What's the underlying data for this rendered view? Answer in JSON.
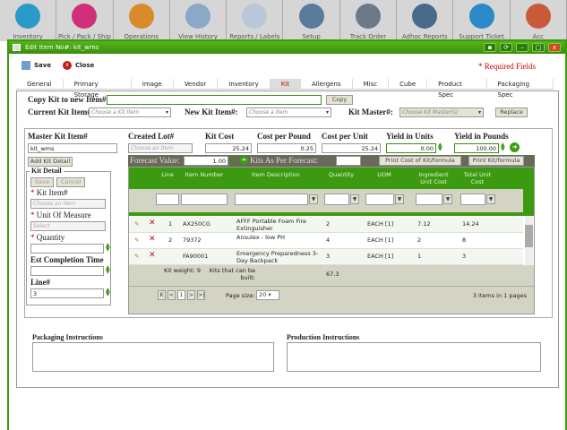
{
  "top_nav": [
    {
      "label": "Inventory",
      "color": "#2a9ac8"
    },
    {
      "label": "Pick / Pack / Ship",
      "color": "#d0307a"
    },
    {
      "label": "Operations",
      "color": "#d98a2a"
    },
    {
      "label": "View History",
      "color": "#8aa8c8"
    },
    {
      "label": "Reports / Labels",
      "color": "#b8c8d8"
    },
    {
      "label": "Setup",
      "color": "#5a7a9a"
    },
    {
      "label": "Track Order",
      "color": "#6a7a8a"
    },
    {
      "label": "Adhoc Reports",
      "color": "#4a6a8a"
    },
    {
      "label": "Support Ticket",
      "color": "#2a8ac8"
    },
    {
      "label": "Acc",
      "color": "#c85a3a"
    }
  ],
  "window": {
    "title": "Edit Item No#: kit_wms",
    "save": "Save",
    "close": "Close",
    "required": "* Required Fields"
  },
  "tabs": [
    "General",
    "Primary Storage",
    "Image",
    "Vendor",
    "Inventory",
    "Kit",
    "Allergens",
    "Misc",
    "Cube",
    "Product Spec",
    "Packaging Spec"
  ],
  "copy": {
    "label": "Copy Kit to new Item#:",
    "value": "",
    "button": "Copy"
  },
  "current_kit": {
    "label": "Current Kit Item#:",
    "placeholder": "Choose a Kit Item"
  },
  "new_kit": {
    "label": "New Kit Item#:",
    "placeholder": "Choose a Item"
  },
  "kit_master": {
    "label": "Kit Master#:",
    "placeholder": "Choose Kit Master(s)",
    "button": "Replace"
  },
  "master": {
    "label": "Master Kit Item#",
    "value": "kit_wms",
    "add_button": "Add Kit Detail"
  },
  "created_lot": {
    "label": "Created Lot#",
    "placeholder": "Choose an Item"
  },
  "kit_cost": {
    "label": "Kit Cost",
    "value": "25.24"
  },
  "cost_per_pound": {
    "label": "Cost per Pound",
    "value": "0.25"
  },
  "cost_per_unit": {
    "label": "Cost per Unit",
    "value": "25.24"
  },
  "yield_units": {
    "label": "Yield in Units",
    "value": "0.00"
  },
  "yield_pounds": {
    "label": "Yield in Pounds",
    "value": "100.00"
  },
  "forecast": {
    "label": "Forecast Value:",
    "value": "1.00",
    "kits_label": "Kits As Per Forecast:",
    "kits_value": "",
    "print_cost": "Print Cost of Kit/formula",
    "print_kit": "Print Kit/formula"
  },
  "kit_detail": {
    "legend": "Kit Detail",
    "save": "Save",
    "cancel": "Cancel",
    "kit_item_label": "Kit Item#",
    "kit_item_placeholder": "Choose an Item",
    "uom_label": "Unit Of Measure",
    "uom_placeholder": "Select",
    "qty_label": "Quantity",
    "qty_value": "",
    "est_label": "Est Completion Time",
    "est_value": "",
    "line_label": "Line#",
    "line_value": "3",
    "star": "*"
  },
  "grid": {
    "headers": [
      "Line",
      "Item Number",
      "Item Description",
      "Quantity",
      "UOM",
      "Ingredient Unit Cost",
      "Total Unit Cost"
    ],
    "rows": [
      [
        "1",
        "AX250CG",
        "AFFF Portable Foam Fire Extinguisher",
        "2",
        "EACH [1]",
        "7.12",
        "14.24"
      ],
      [
        "2",
        "79372",
        "Ansulex - low PH",
        "4",
        "EACH [1]",
        "2",
        "8"
      ],
      [
        "",
        "FA90001",
        "Emergency Preparedness 3-Day Backpack",
        "3",
        "EACH [1]",
        "1",
        "3"
      ]
    ],
    "footer": {
      "kit_weight": "Kit weight: 9",
      "kits_built_label": "Kits that can be built:",
      "kits_built": "67.3"
    },
    "pager": {
      "page": "1",
      "page_size_label": "Page size:",
      "page_size": "20",
      "summary": "3 items in 1 pages"
    }
  },
  "packaging": {
    "label": "Packaging Instructions",
    "value": ""
  },
  "production": {
    "label": "Production Instructions",
    "value": ""
  }
}
